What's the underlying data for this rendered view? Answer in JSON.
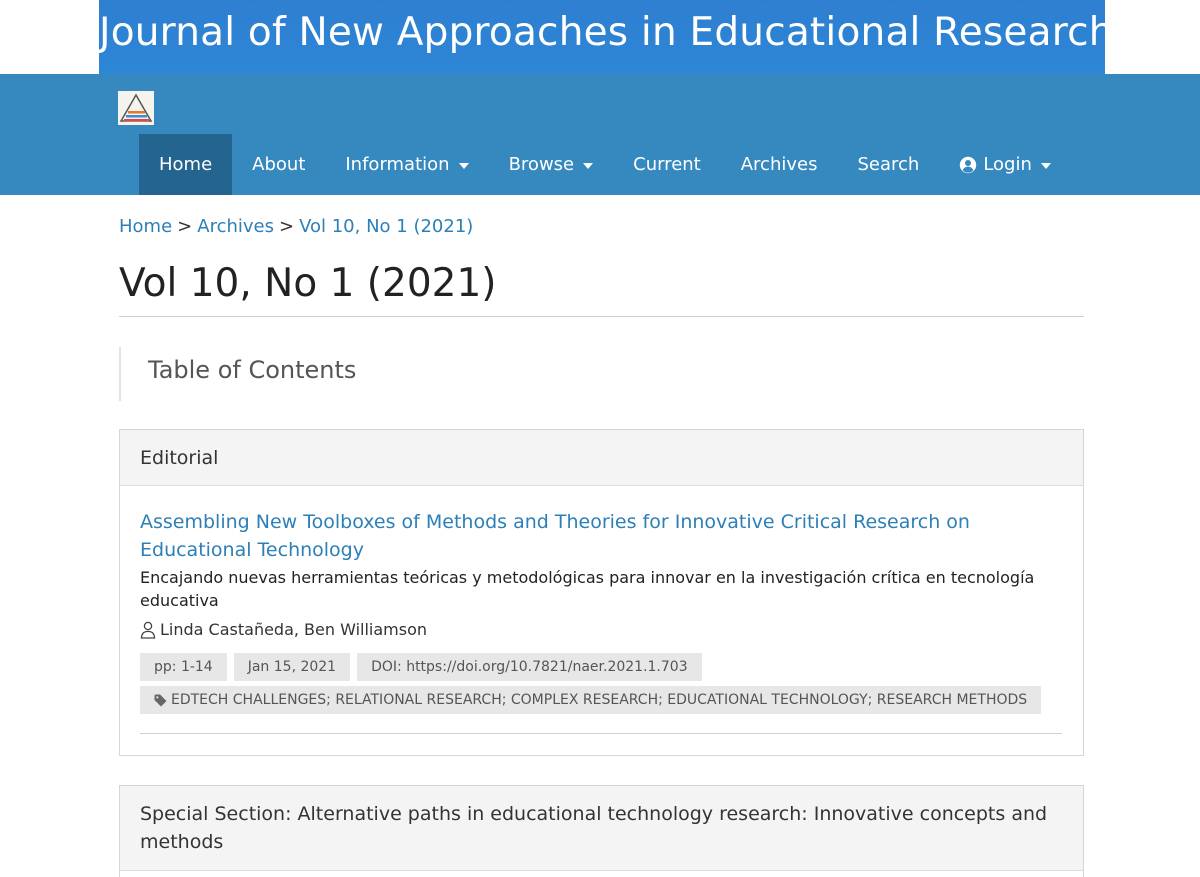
{
  "banner": {
    "title": "Journal of New Approaches in Educational Research"
  },
  "nav": {
    "items": [
      {
        "label": "Home",
        "active": true,
        "dropdown": false
      },
      {
        "label": "About",
        "active": false,
        "dropdown": false
      },
      {
        "label": "Information",
        "active": false,
        "dropdown": true
      },
      {
        "label": "Browse",
        "active": false,
        "dropdown": true
      },
      {
        "label": "Current",
        "active": false,
        "dropdown": false
      },
      {
        "label": "Archives",
        "active": false,
        "dropdown": false
      },
      {
        "label": "Search",
        "active": false,
        "dropdown": false
      },
      {
        "label": "Login",
        "active": false,
        "dropdown": true,
        "icon": "user-circle-icon"
      }
    ]
  },
  "breadcrumb": {
    "items": [
      "Home",
      "Archives",
      "Vol 10, No 1 (2021)"
    ],
    "separator": ">"
  },
  "page_title": "Vol 10, No 1 (2021)",
  "toc": {
    "heading": "Table of Contents"
  },
  "sections": [
    {
      "title": "Editorial",
      "articles": [
        {
          "title": "Assembling New Toolboxes of Methods and Theories for Innovative Critical Research on Educational Technology",
          "subtitle": "Encajando nuevas herramientas teóricas y metodológicas para innovar en la investigación crítica en tecnología educativa",
          "authors": "Linda Castañeda, Ben Williamson",
          "pages": "pp: 1-14",
          "date": "Jan 15, 2021",
          "doi": "DOI: https://doi.org/10.7821/naer.2021.1.703",
          "keywords": "EDTECH CHALLENGES; RELATIONAL RESEARCH; COMPLEX RESEARCH; EDUCATIONAL TECHNOLOGY; RESEARCH METHODS"
        }
      ]
    },
    {
      "title": "Special Section: Alternative paths in educational technology research: Innovative concepts and methods"
    }
  ],
  "colors": {
    "banner": "#2d86d6",
    "navbar": "#3689bf",
    "nav_active": "#24658f",
    "link": "#2d7fb8"
  }
}
